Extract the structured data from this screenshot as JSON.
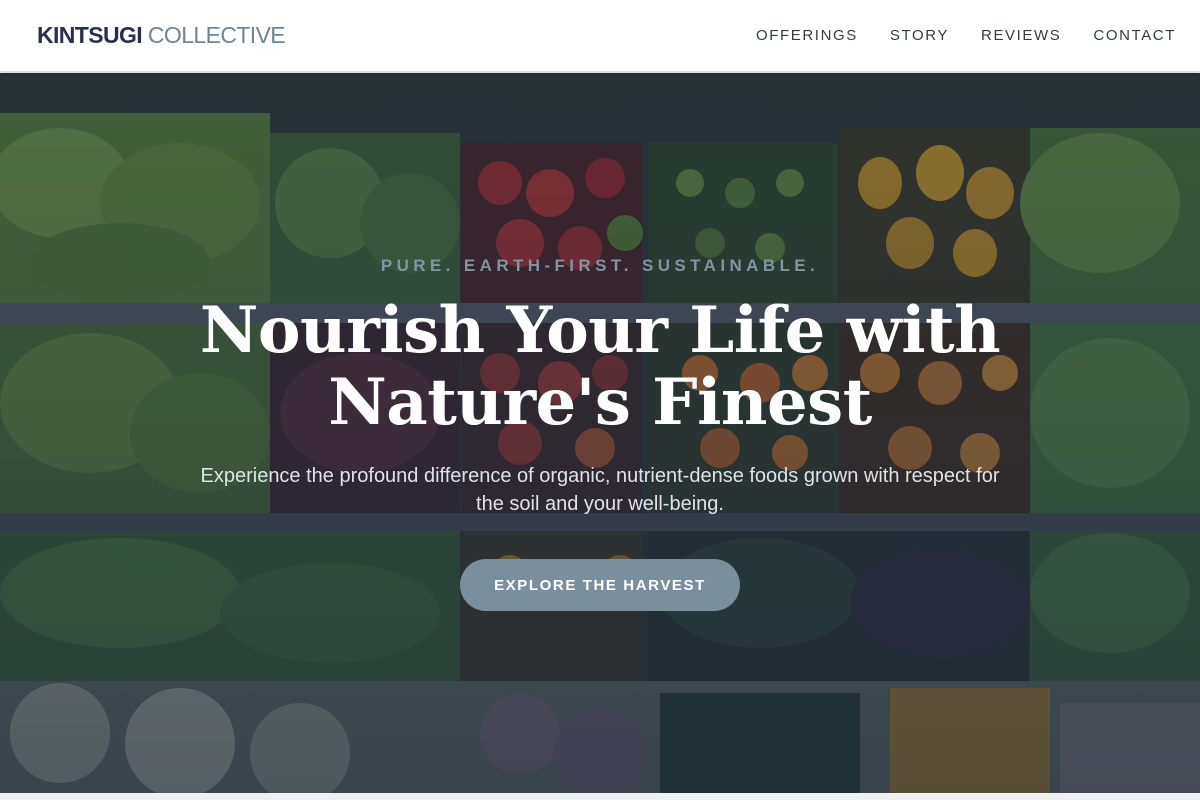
{
  "header": {
    "brand_primary": "KINTSUGI",
    "brand_secondary": "COLLECTIVE",
    "nav": [
      {
        "label": "OFFERINGS"
      },
      {
        "label": "STORY"
      },
      {
        "label": "REVIEWS"
      },
      {
        "label": "CONTACT"
      }
    ]
  },
  "hero": {
    "eyebrow": "PURE. EARTH-FIRST. SUSTAINABLE.",
    "headline_line1": "Nourish Your Life with",
    "headline_line2": "Nature's Finest",
    "subline": "Experience the profound difference of organic, nutrient-dense foods grown with respect for the soil and your well-being.",
    "cta_label": "EXPLORE THE HARVEST"
  },
  "colors": {
    "brand_dark": "#27324a",
    "brand_accent": "#6e8594",
    "cta_bg": "#7b8e9c",
    "overlay": "#232a3a"
  }
}
